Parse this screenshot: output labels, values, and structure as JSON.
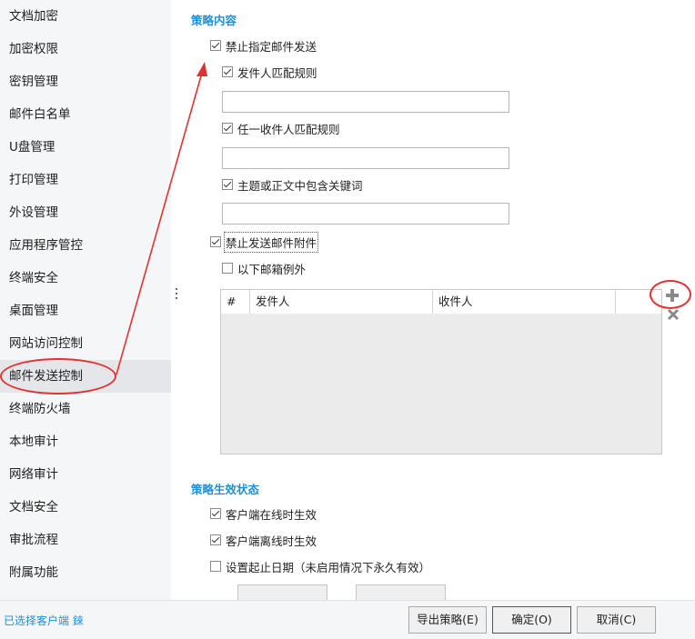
{
  "sidebar": {
    "items": [
      {
        "label": "文档加密"
      },
      {
        "label": "加密权限"
      },
      {
        "label": "密钥管理"
      },
      {
        "label": "邮件白名单"
      },
      {
        "label": "U盘管理"
      },
      {
        "label": "打印管理"
      },
      {
        "label": "外设管理"
      },
      {
        "label": "应用程序管控"
      },
      {
        "label": "终端安全"
      },
      {
        "label": "桌面管理"
      },
      {
        "label": "网站访问控制"
      },
      {
        "label": "邮件发送控制"
      },
      {
        "label": "终端防火墙"
      },
      {
        "label": "本地审计"
      },
      {
        "label": "网络审计"
      },
      {
        "label": "文档安全"
      },
      {
        "label": "审批流程"
      },
      {
        "label": "附属功能"
      }
    ],
    "active_index": 11
  },
  "policy": {
    "section_title": "策略内容",
    "block_specified_mail": {
      "label": "禁止指定邮件发送",
      "checked": true
    },
    "sender_rule": {
      "label": "发件人匹配规则",
      "checked": true,
      "value": ""
    },
    "any_recipient_rule": {
      "label": "任一收件人匹配规则",
      "checked": true,
      "value": ""
    },
    "keyword_rule": {
      "label": "主题或正文中包含关键词",
      "checked": true,
      "value": ""
    },
    "block_attachments": {
      "label": "禁止发送邮件附件",
      "checked": true
    },
    "mailbox_exception": {
      "label": "以下邮箱例外",
      "checked": false
    },
    "grid": {
      "columns": [
        "#",
        "发件人",
        "收件人"
      ],
      "rows": []
    }
  },
  "status": {
    "section_title": "策略生效状态",
    "online": {
      "label": "客户端在线时生效",
      "checked": true
    },
    "offline": {
      "label": "客户端离线时生效",
      "checked": true
    },
    "date_range": {
      "label": "设置起止日期（未启用情况下永久有效）",
      "checked": false
    }
  },
  "footer": {
    "selected_clients": "已选择客户端 錸",
    "export_button": "导出策略(E)",
    "ok_button": "确定(O)",
    "cancel_button": "取消(C)"
  },
  "icons": {
    "add": "plus-icon",
    "remove": "close-x-icon"
  },
  "colors": {
    "accent": "#1f8fd6",
    "annotation": "#e03232",
    "sidebar_bg": "#f5f6f7",
    "active_bg": "#e4e6e9"
  }
}
